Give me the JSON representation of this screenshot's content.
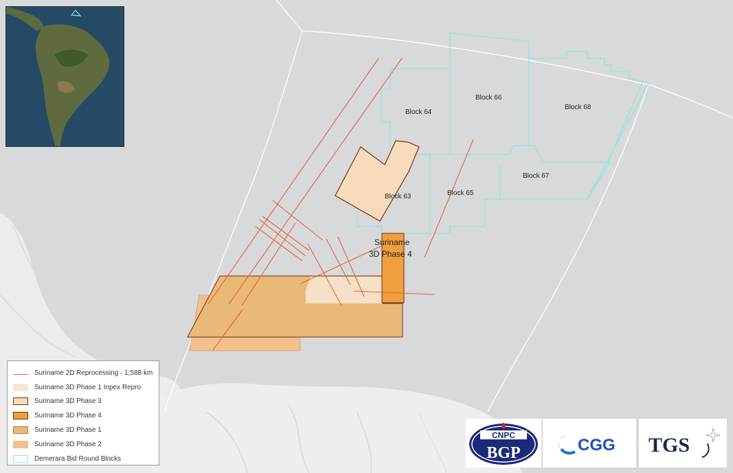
{
  "map": {
    "background_color": "#d7d9da",
    "land_color": "#eeeeee",
    "blocks": [
      {
        "id": "block-64",
        "label": "Block 64"
      },
      {
        "id": "block-66",
        "label": "Block 66"
      },
      {
        "id": "block-68",
        "label": "Block 68"
      },
      {
        "id": "block-67",
        "label": "Block 67"
      },
      {
        "id": "block-65",
        "label": "Block 65"
      },
      {
        "id": "block-63",
        "label": "Block 63"
      }
    ],
    "survey_label_line1": "Suriname",
    "survey_label_line2": "3D Phase 4"
  },
  "legend": {
    "items": [
      {
        "label": "Suriname 2D Reprocessing - 1,588 km",
        "symbol": "line",
        "color": "#e8623a"
      },
      {
        "label": "Suriname 3D Phase 1 Inpex Repro",
        "symbol": "fill",
        "color": "#f7e8d6"
      },
      {
        "label": "Suriname 3D Phase 3",
        "symbol": "fill",
        "color": "#f6dcbb"
      },
      {
        "label": "Suriname 3D Phase 4",
        "symbol": "fill",
        "color": "#ee9f3e"
      },
      {
        "label": "Suriname 3D Phase 1",
        "symbol": "fill",
        "color": "#e9b978"
      },
      {
        "label": "Suriname 3D Phase 2",
        "symbol": "fill",
        "color": "#f2c08c"
      },
      {
        "label": "Demerara Bid Round Blocks",
        "symbol": "outline",
        "color": "#8ee6e0"
      }
    ]
  },
  "logos": {
    "cnpc": "CNPC",
    "bgp": "BGP",
    "cgg": "CGG",
    "tgs": "TGS"
  }
}
